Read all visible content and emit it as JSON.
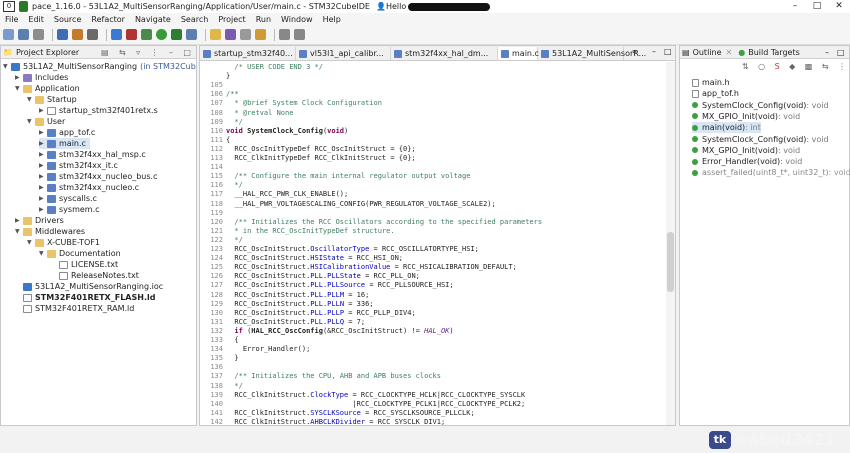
{
  "window": {
    "title": "pace_1.16.0 - 53L1A2_MultiSensorRanging/Application/User/main.c - STM32CubeIDE",
    "box_label": "0",
    "hello": "Hello"
  },
  "menu": [
    "File",
    "Edit",
    "Source",
    "Refactor",
    "Navigate",
    "Search",
    "Project",
    "Run",
    "Window",
    "Help"
  ],
  "project_explorer": {
    "title": "Project Explorer",
    "items": [
      {
        "label": "53L1A2_MultiSensorRanging",
        "suffix": "(in STM32CubeIDE)",
        "icon": "project-icon"
      },
      {
        "label": "Includes",
        "icon": "includes-icon"
      },
      {
        "label": "Application",
        "icon": "folder-icon"
      },
      {
        "label": "Startup",
        "icon": "folder-icon"
      },
      {
        "label": "startup_stm32f401retx.s",
        "icon": "file-icon"
      },
      {
        "label": "User",
        "icon": "folder-icon"
      },
      {
        "label": "app_tof.c",
        "icon": "c-file-icon"
      },
      {
        "label": "main.c",
        "icon": "c-file-icon"
      },
      {
        "label": "stm32f4xx_hal_msp.c",
        "icon": "c-file-icon"
      },
      {
        "label": "stm32f4xx_it.c",
        "icon": "c-file-icon"
      },
      {
        "label": "stm32f4xx_nucleo_bus.c",
        "icon": "c-file-icon"
      },
      {
        "label": "stm32f4xx_nucleo.c",
        "icon": "c-file-icon"
      },
      {
        "label": "syscalls.c",
        "icon": "c-file-icon"
      },
      {
        "label": "sysmem.c",
        "icon": "c-file-icon"
      },
      {
        "label": "Drivers",
        "icon": "folder-icon"
      },
      {
        "label": "Middlewares",
        "icon": "folder-icon"
      },
      {
        "label": "X-CUBE-TOF1",
        "icon": "folder-icon"
      },
      {
        "label": "Documentation",
        "icon": "folder-icon"
      },
      {
        "label": "LICENSE.txt",
        "icon": "file-icon"
      },
      {
        "label": "ReleaseNotes.txt",
        "icon": "file-icon"
      },
      {
        "label": "53L1A2_MultiSensorRanging.ioc",
        "icon": "ioc-file-icon"
      },
      {
        "label": "STM32F401RETX_FLASH.ld",
        "icon": "file-icon"
      },
      {
        "label": "STM32F401RETX_RAM.ld",
        "icon": "file-icon"
      }
    ]
  },
  "tabs": [
    "startup_stm32f40...",
    "vl53l1_api_calibr...",
    "stm32f4xx_hal_dm...",
    "main.c",
    "53L1A2_MultiSensorR..."
  ],
  "editor": {
    "lines": [
      {
        "n": "",
        "parts": [
          [
            "cm",
            "  /* USER CODE END 3 */"
          ]
        ]
      },
      {
        "n": "",
        "parts": [
          [
            "",
            "}"
          ]
        ]
      },
      {
        "n": "105",
        "parts": [
          [
            "",
            ""
          ]
        ]
      },
      {
        "n": "106",
        "parts": [
          [
            "cm",
            "/**"
          ]
        ]
      },
      {
        "n": "107",
        "parts": [
          [
            "cm",
            "  * @brief System Clock Configuration"
          ]
        ]
      },
      {
        "n": "108",
        "parts": [
          [
            "cm",
            "  * @retval None"
          ]
        ]
      },
      {
        "n": "109",
        "parts": [
          [
            "cm",
            "  */"
          ]
        ]
      },
      {
        "n": "110",
        "parts": [
          [
            "kw",
            "void "
          ],
          [
            "bold",
            "SystemClock_Config"
          ],
          [
            "",
            "("
          ],
          [
            "kw",
            "void"
          ],
          [
            "",
            ")"
          ]
        ]
      },
      {
        "n": "111",
        "parts": [
          [
            "",
            "{"
          ]
        ]
      },
      {
        "n": "112",
        "parts": [
          [
            "",
            "  RCC_OscInitTypeDef RCC_OscInitStruct = {0};"
          ]
        ]
      },
      {
        "n": "113",
        "parts": [
          [
            "",
            "  RCC_ClkInitTypeDef RCC_ClkInitStruct = {0};"
          ]
        ]
      },
      {
        "n": "114",
        "parts": [
          [
            "",
            ""
          ]
        ]
      },
      {
        "n": "115",
        "parts": [
          [
            "cm",
            "  /** Configure the main internal regulator output voltage"
          ]
        ]
      },
      {
        "n": "116",
        "parts": [
          [
            "cm",
            "  */"
          ]
        ]
      },
      {
        "n": "117",
        "parts": [
          [
            "",
            "  __HAL_RCC_PWR_CLK_ENABLE();"
          ]
        ]
      },
      {
        "n": "118",
        "parts": [
          [
            "",
            "  __HAL_PWR_VOLTAGESCALING_CONFIG(PWR_REGULATOR_VOLTAGE_SCALE2);"
          ]
        ]
      },
      {
        "n": "119",
        "parts": [
          [
            "",
            ""
          ]
        ]
      },
      {
        "n": "120",
        "parts": [
          [
            "cm",
            "  /** Initializes the RCC Oscillators according to the specified parameters"
          ]
        ]
      },
      {
        "n": "121",
        "parts": [
          [
            "cm",
            "  * in the RCC_OscInitTypeDef structure."
          ]
        ]
      },
      {
        "n": "122",
        "parts": [
          [
            "cm",
            "  */"
          ]
        ]
      },
      {
        "n": "123",
        "parts": [
          [
            "",
            "  RCC_OscInitStruct."
          ],
          [
            "fld",
            "OscillatorType"
          ],
          [
            "",
            " = RCC_OSCILLATORTYPE_HSI;"
          ]
        ]
      },
      {
        "n": "124",
        "parts": [
          [
            "",
            "  RCC_OscInitStruct."
          ],
          [
            "fld",
            "HSIState"
          ],
          [
            "",
            " = RCC_HSI_ON;"
          ]
        ]
      },
      {
        "n": "125",
        "parts": [
          [
            "",
            "  RCC_OscInitStruct."
          ],
          [
            "fld",
            "HSICalibrationValue"
          ],
          [
            "",
            " = RCC_HSICALIBRATION_DEFAULT;"
          ]
        ]
      },
      {
        "n": "126",
        "parts": [
          [
            "",
            "  RCC_OscInitStruct."
          ],
          [
            "fld",
            "PLL"
          ],
          [
            "",
            "."
          ],
          [
            "fld",
            "PLLState"
          ],
          [
            "",
            " = RCC_PLL_ON;"
          ]
        ]
      },
      {
        "n": "127",
        "parts": [
          [
            "",
            "  RCC_OscInitStruct."
          ],
          [
            "fld",
            "PLL"
          ],
          [
            "",
            "."
          ],
          [
            "fld",
            "PLLSource"
          ],
          [
            "",
            " = RCC_PLLSOURCE_HSI;"
          ]
        ]
      },
      {
        "n": "128",
        "parts": [
          [
            "",
            "  RCC_OscInitStruct."
          ],
          [
            "fld",
            "PLL"
          ],
          [
            "",
            "."
          ],
          [
            "fld",
            "PLLM"
          ],
          [
            "",
            " = 16;"
          ]
        ]
      },
      {
        "n": "129",
        "parts": [
          [
            "",
            "  RCC_OscInitStruct."
          ],
          [
            "fld",
            "PLL"
          ],
          [
            "",
            "."
          ],
          [
            "fld",
            "PLLN"
          ],
          [
            "",
            " = 336;"
          ]
        ]
      },
      {
        "n": "130",
        "parts": [
          [
            "",
            "  RCC_OscInitStruct."
          ],
          [
            "fld",
            "PLL"
          ],
          [
            "",
            "."
          ],
          [
            "fld",
            "PLLP"
          ],
          [
            "",
            " = RCC_PLLP_DIV4;"
          ]
        ]
      },
      {
        "n": "131",
        "parts": [
          [
            "",
            "  RCC_OscInitStruct."
          ],
          [
            "fld",
            "PLL"
          ],
          [
            "",
            "."
          ],
          [
            "fld",
            "PLLQ"
          ],
          [
            "",
            " = 7;"
          ]
        ]
      },
      {
        "n": "132",
        "parts": [
          [
            "kw",
            "  if"
          ],
          [
            "",
            " ("
          ],
          [
            "bold",
            "HAL_RCC_OscConfig"
          ],
          [
            "",
            "(&RCC_OscInitStruct) != "
          ],
          [
            "itl",
            "HAL_OK"
          ],
          [
            "",
            ")"
          ]
        ]
      },
      {
        "n": "133",
        "parts": [
          [
            "",
            "  {"
          ]
        ]
      },
      {
        "n": "134",
        "parts": [
          [
            "",
            "    Error_Handler();"
          ]
        ]
      },
      {
        "n": "135",
        "parts": [
          [
            "",
            "  }"
          ]
        ]
      },
      {
        "n": "136",
        "parts": [
          [
            "",
            ""
          ]
        ]
      },
      {
        "n": "137",
        "parts": [
          [
            "cm",
            "  /** Initializes the CPU, AHB and APB buses clocks"
          ]
        ]
      },
      {
        "n": "138",
        "parts": [
          [
            "cm",
            "  */"
          ]
        ]
      },
      {
        "n": "139",
        "parts": [
          [
            "",
            "  RCC_ClkInitStruct."
          ],
          [
            "fld",
            "ClockType"
          ],
          [
            "",
            " = RCC_CLOCKTYPE_HCLK|RCC_CLOCKTYPE_SYSCLK"
          ]
        ]
      },
      {
        "n": "140",
        "parts": [
          [
            "",
            "                              |RCC_CLOCKTYPE_PCLK1|RCC_CLOCKTYPE_PCLK2;"
          ]
        ]
      },
      {
        "n": "141",
        "parts": [
          [
            "",
            "  RCC_ClkInitStruct."
          ],
          [
            "fld",
            "SYSCLKSource"
          ],
          [
            "",
            " = RCC_SYSCLKSOURCE_PLLCLK;"
          ]
        ]
      },
      {
        "n": "142",
        "parts": [
          [
            "",
            "  RCC_ClkInitStruct."
          ],
          [
            "fld",
            "AHBCLKDivider"
          ],
          [
            "",
            " = RCC_SYSCLK_DIV1;"
          ]
        ]
      }
    ]
  },
  "outline": {
    "tab_outline": "Outline",
    "tab_build": "Build Targets",
    "items": [
      {
        "label": "main.h",
        "type": "",
        "icon": "header-include-icon"
      },
      {
        "label": "app_tof.h",
        "type": "",
        "icon": "header-include-icon"
      },
      {
        "label": "SystemClock_Config(void)",
        "type": " : void",
        "icon": "function-icon"
      },
      {
        "label": "MX_GPIO_Init(void)",
        "type": " : void",
        "icon": "static-function-icon"
      },
      {
        "label": "main(void)",
        "type": " : int",
        "icon": "function-icon"
      },
      {
        "label": "SystemClock_Config(void)",
        "type": " : void",
        "icon": "function-icon"
      },
      {
        "label": "MX_GPIO_Init(void)",
        "type": " : void",
        "icon": "static-function-icon"
      },
      {
        "label": "Error_Handler(void)",
        "type": " : void",
        "icon": "function-icon"
      },
      {
        "label": "assert_failed(uint8_t*, uint32_t)",
        "type": " : void",
        "icon": "function-icon"
      }
    ]
  },
  "watermark": {
    "text": "+abcd3421",
    "logo": "tk"
  }
}
